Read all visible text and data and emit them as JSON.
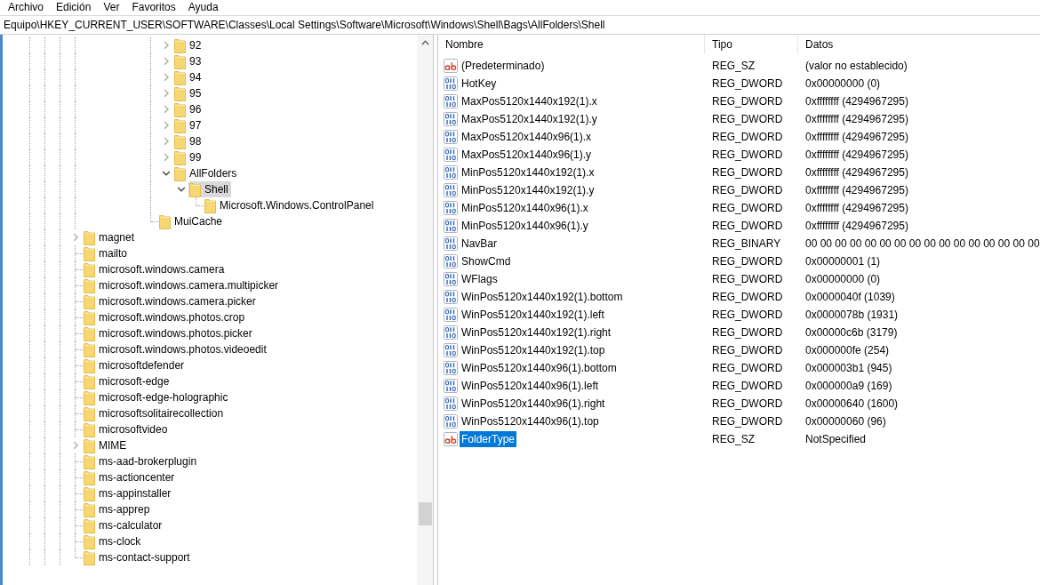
{
  "menu": [
    "Archivo",
    "Edición",
    "Ver",
    "Favoritos",
    "Ayuda"
  ],
  "address_bar": {
    "value": "Equipo\\HKEY_CURRENT_USER\\SOFTWARE\\Classes\\Local Settings\\Software\\Microsoft\\Windows\\Shell\\Bags\\AllFolders\\Shell"
  },
  "tree": {
    "items": [
      {
        "children": [
          {
            "children": [
              {
                "children": [
                  {
                    "children": [
                      {
                        "children": [
                          {
                            "children": [
                              {
                                "label": "92",
                                "kind": "branch",
                                "expanded": false,
                                "selected": false
                              },
                              {
                                "label": "93",
                                "kind": "branch",
                                "expanded": false,
                                "selected": false
                              },
                              {
                                "label": "94",
                                "kind": "branch",
                                "expanded": false,
                                "selected": false
                              },
                              {
                                "label": "95",
                                "kind": "branch",
                                "expanded": false,
                                "selected": false
                              },
                              {
                                "label": "96",
                                "kind": "branch",
                                "expanded": false,
                                "selected": false
                              },
                              {
                                "label": "97",
                                "kind": "branch",
                                "expanded": false,
                                "selected": false
                              },
                              {
                                "label": "98",
                                "kind": "branch",
                                "expanded": false,
                                "selected": false
                              },
                              {
                                "label": "99",
                                "kind": "branch",
                                "expanded": false,
                                "selected": false
                              },
                              {
                                "label": "AllFolders",
                                "kind": "branch",
                                "expanded": true,
                                "selected": false,
                                "children": [
                                  {
                                    "label": "Shell",
                                    "kind": "branch",
                                    "expanded": true,
                                    "selected": true,
                                    "children": [
                                      {
                                        "label": "Microsoft.Windows.ControlPanel",
                                        "kind": "leaf",
                                        "selected": false
                                      }
                                    ]
                                  }
                                ]
                              }
                            ]
                          },
                          {
                            "label": "MuiCache",
                            "kind": "leaf",
                            "selected": false
                          }
                        ]
                      }
                    ]
                  }
                ]
              }
            ]
          }
        ]
      },
      {
        "label": "magnet",
        "kind": "branch",
        "expanded": false,
        "selected": false
      },
      {
        "label": "mailto",
        "kind": "leaf",
        "selected": false
      },
      {
        "label": "microsoft.windows.camera",
        "kind": "leaf",
        "selected": false
      },
      {
        "label": "microsoft.windows.camera.multipicker",
        "kind": "leaf",
        "selected": false
      },
      {
        "label": "microsoft.windows.camera.picker",
        "kind": "leaf",
        "selected": false
      },
      {
        "label": "microsoft.windows.photos.crop",
        "kind": "leaf",
        "selected": false
      },
      {
        "label": "microsoft.windows.photos.picker",
        "kind": "leaf",
        "selected": false
      },
      {
        "label": "microsoft.windows.photos.videoedit",
        "kind": "leaf",
        "selected": false
      },
      {
        "label": "microsoftdefender",
        "kind": "leaf",
        "selected": false
      },
      {
        "label": "microsoft-edge",
        "kind": "leaf",
        "selected": false
      },
      {
        "label": "microsoft-edge-holographic",
        "kind": "leaf",
        "selected": false
      },
      {
        "label": "microsoftsolitairecollection",
        "kind": "leaf",
        "selected": false
      },
      {
        "label": "microsoftvideo",
        "kind": "leaf",
        "selected": false
      },
      {
        "label": "MIME",
        "kind": "branch",
        "expanded": false,
        "selected": false
      },
      {
        "label": "ms-aad-brokerplugin",
        "kind": "leaf",
        "selected": false
      },
      {
        "label": "ms-actioncenter",
        "kind": "leaf",
        "selected": false
      },
      {
        "label": "ms-appinstaller",
        "kind": "leaf",
        "selected": false
      },
      {
        "label": "ms-apprep",
        "kind": "leaf",
        "selected": false
      },
      {
        "label": "ms-calculator",
        "kind": "leaf",
        "selected": false
      },
      {
        "label": "ms-clock",
        "kind": "leaf",
        "selected": false
      },
      {
        "label": "ms-contact-support",
        "kind": "leaf",
        "selected": false
      }
    ]
  },
  "list": {
    "columns": [
      "Nombre",
      "Tipo",
      "Datos"
    ],
    "rows": [
      {
        "kind": "string",
        "name": "(Predeterminado)",
        "type": "REG_SZ",
        "data": "(valor no establecido)",
        "selected": false
      },
      {
        "kind": "binary",
        "name": "HotKey",
        "type": "REG_DWORD",
        "data": "0x00000000 (0)",
        "selected": false
      },
      {
        "kind": "binary",
        "name": "MaxPos5120x1440x192(1).x",
        "type": "REG_DWORD",
        "data": "0xffffffff (4294967295)",
        "selected": false
      },
      {
        "kind": "binary",
        "name": "MaxPos5120x1440x192(1).y",
        "type": "REG_DWORD",
        "data": "0xffffffff (4294967295)",
        "selected": false
      },
      {
        "kind": "binary",
        "name": "MaxPos5120x1440x96(1).x",
        "type": "REG_DWORD",
        "data": "0xffffffff (4294967295)",
        "selected": false
      },
      {
        "kind": "binary",
        "name": "MaxPos5120x1440x96(1).y",
        "type": "REG_DWORD",
        "data": "0xffffffff (4294967295)",
        "selected": false
      },
      {
        "kind": "binary",
        "name": "MinPos5120x1440x192(1).x",
        "type": "REG_DWORD",
        "data": "0xffffffff (4294967295)",
        "selected": false
      },
      {
        "kind": "binary",
        "name": "MinPos5120x1440x192(1).y",
        "type": "REG_DWORD",
        "data": "0xffffffff (4294967295)",
        "selected": false
      },
      {
        "kind": "binary",
        "name": "MinPos5120x1440x96(1).x",
        "type": "REG_DWORD",
        "data": "0xffffffff (4294967295)",
        "selected": false
      },
      {
        "kind": "binary",
        "name": "MinPos5120x1440x96(1).y",
        "type": "REG_DWORD",
        "data": "0xffffffff (4294967295)",
        "selected": false
      },
      {
        "kind": "binary",
        "name": "NavBar",
        "type": "REG_BINARY",
        "data": "00 00 00 00 00 00 00 00 00 00 00 00 00 00 00 00",
        "selected": false
      },
      {
        "kind": "binary",
        "name": "ShowCmd",
        "type": "REG_DWORD",
        "data": "0x00000001 (1)",
        "selected": false
      },
      {
        "kind": "binary",
        "name": "WFlags",
        "type": "REG_DWORD",
        "data": "0x00000000 (0)",
        "selected": false
      },
      {
        "kind": "binary",
        "name": "WinPos5120x1440x192(1).bottom",
        "type": "REG_DWORD",
        "data": "0x0000040f (1039)",
        "selected": false
      },
      {
        "kind": "binary",
        "name": "WinPos5120x1440x192(1).left",
        "type": "REG_DWORD",
        "data": "0x0000078b (1931)",
        "selected": false
      },
      {
        "kind": "binary",
        "name": "WinPos5120x1440x192(1).right",
        "type": "REG_DWORD",
        "data": "0x00000c6b (3179)",
        "selected": false
      },
      {
        "kind": "binary",
        "name": "WinPos5120x1440x192(1).top",
        "type": "REG_DWORD",
        "data": "0x000000fe (254)",
        "selected": false
      },
      {
        "kind": "binary",
        "name": "WinPos5120x1440x96(1).bottom",
        "type": "REG_DWORD",
        "data": "0x000003b1 (945)",
        "selected": false
      },
      {
        "kind": "binary",
        "name": "WinPos5120x1440x96(1).left",
        "type": "REG_DWORD",
        "data": "0x000000a9 (169)",
        "selected": false
      },
      {
        "kind": "binary",
        "name": "WinPos5120x1440x96(1).right",
        "type": "REG_DWORD",
        "data": "0x00000640 (1600)",
        "selected": false
      },
      {
        "kind": "binary",
        "name": "WinPos5120x1440x96(1).top",
        "type": "REG_DWORD",
        "data": "0x00000060 (96)",
        "selected": false
      },
      {
        "kind": "string",
        "name": "FolderType",
        "type": "REG_SZ",
        "data": "NotSpecified",
        "selected": true
      }
    ]
  }
}
